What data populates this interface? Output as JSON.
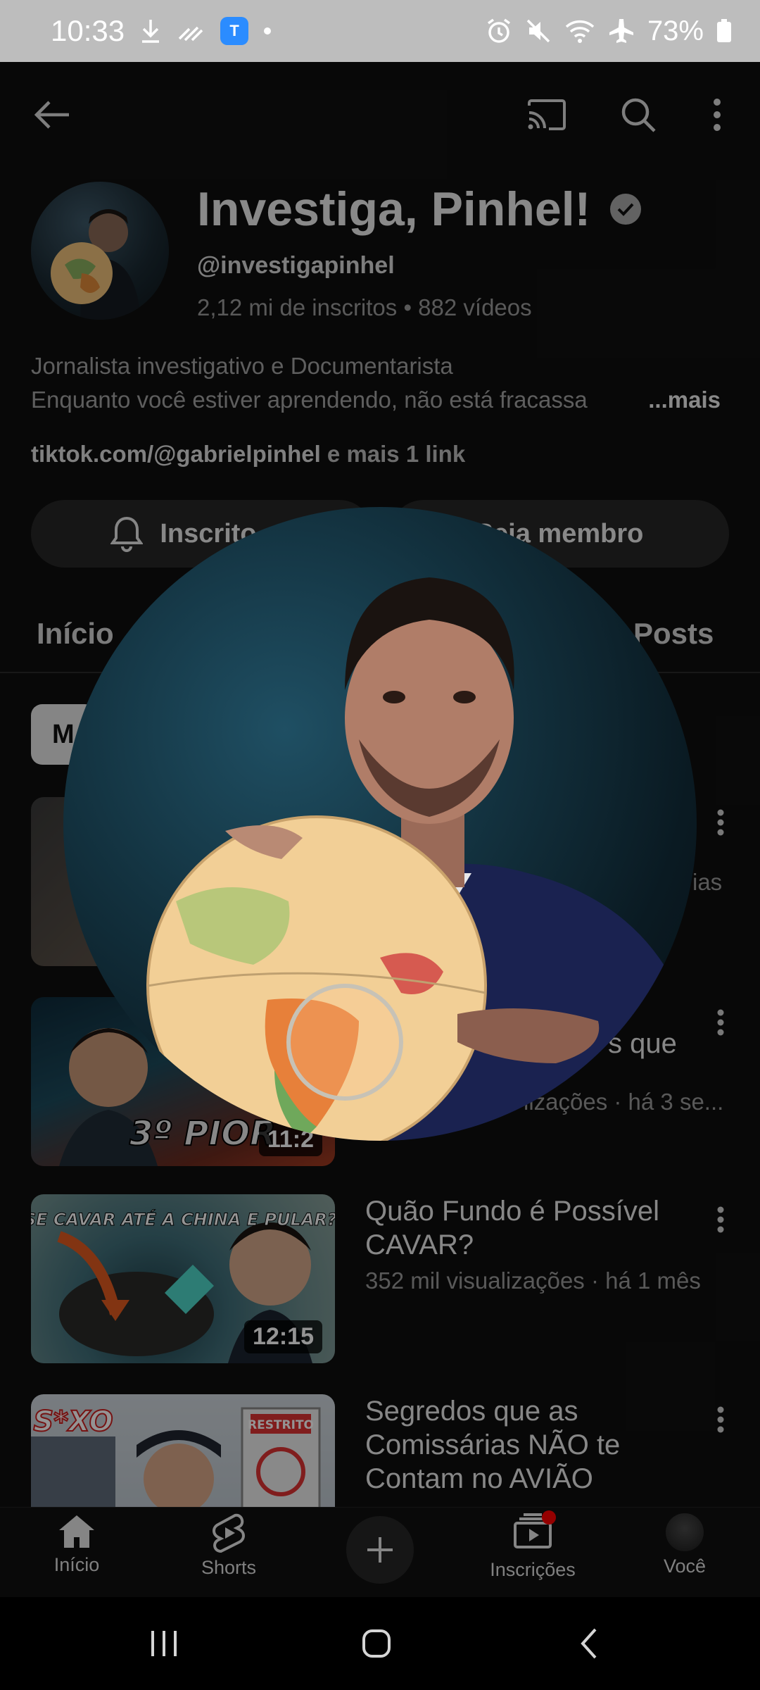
{
  "status_bar": {
    "time": "10:33",
    "app_badge": "T",
    "battery": "73%"
  },
  "topbar": {
    "back_icon": "arrow-left-icon",
    "cast_icon": "cast-icon",
    "search_icon": "search-icon",
    "more_icon": "more-vert-icon"
  },
  "channel": {
    "name": "Investiga, Pinhel!",
    "handle": "@investigapinhel",
    "stats": "2,12 mi de inscritos • 882 vídeos",
    "description_line1": "Jornalista investigativo e Documentarista",
    "description_line2": "Enquanto você estiver aprendendo, não está fracassa",
    "more_label": "...mais",
    "link_main": "tiktok.com/@gabrielpinhel",
    "link_extra": " e mais 1 link",
    "subscribed_label": "Inscrito",
    "join_label": "Seja membro"
  },
  "tabs": [
    "Início",
    "Posts"
  ],
  "chip_label": "M",
  "videos": [
    {
      "title": "",
      "meta": "ias",
      "duration": ""
    },
    {
      "title": "s que",
      "meta": "lizações · há 3 se...",
      "duration": "11:2",
      "thumb_text": "3º PIOR"
    },
    {
      "title": "Quão Fundo é Possível CAVAR?",
      "meta": "352 mil visualizações · há 1 mês",
      "duration": "12:15",
      "thumb_text": "E SE CAVAR ATÉ A CHINA E PULAR?"
    },
    {
      "title": "Segredos que as Comissárias NÃO te Contam no AVIÃO",
      "meta": "",
      "duration": "",
      "thumb_text": "S*XO",
      "thumb_sign": "RESTRITO"
    }
  ],
  "bottom_nav": {
    "home": "Início",
    "shorts": "Shorts",
    "subscriptions": "Inscrições",
    "you": "Você"
  },
  "colors": {
    "background": "#0f0f0f",
    "accent_red": "#ff0000",
    "chip_bg": "#e5e5e5"
  }
}
